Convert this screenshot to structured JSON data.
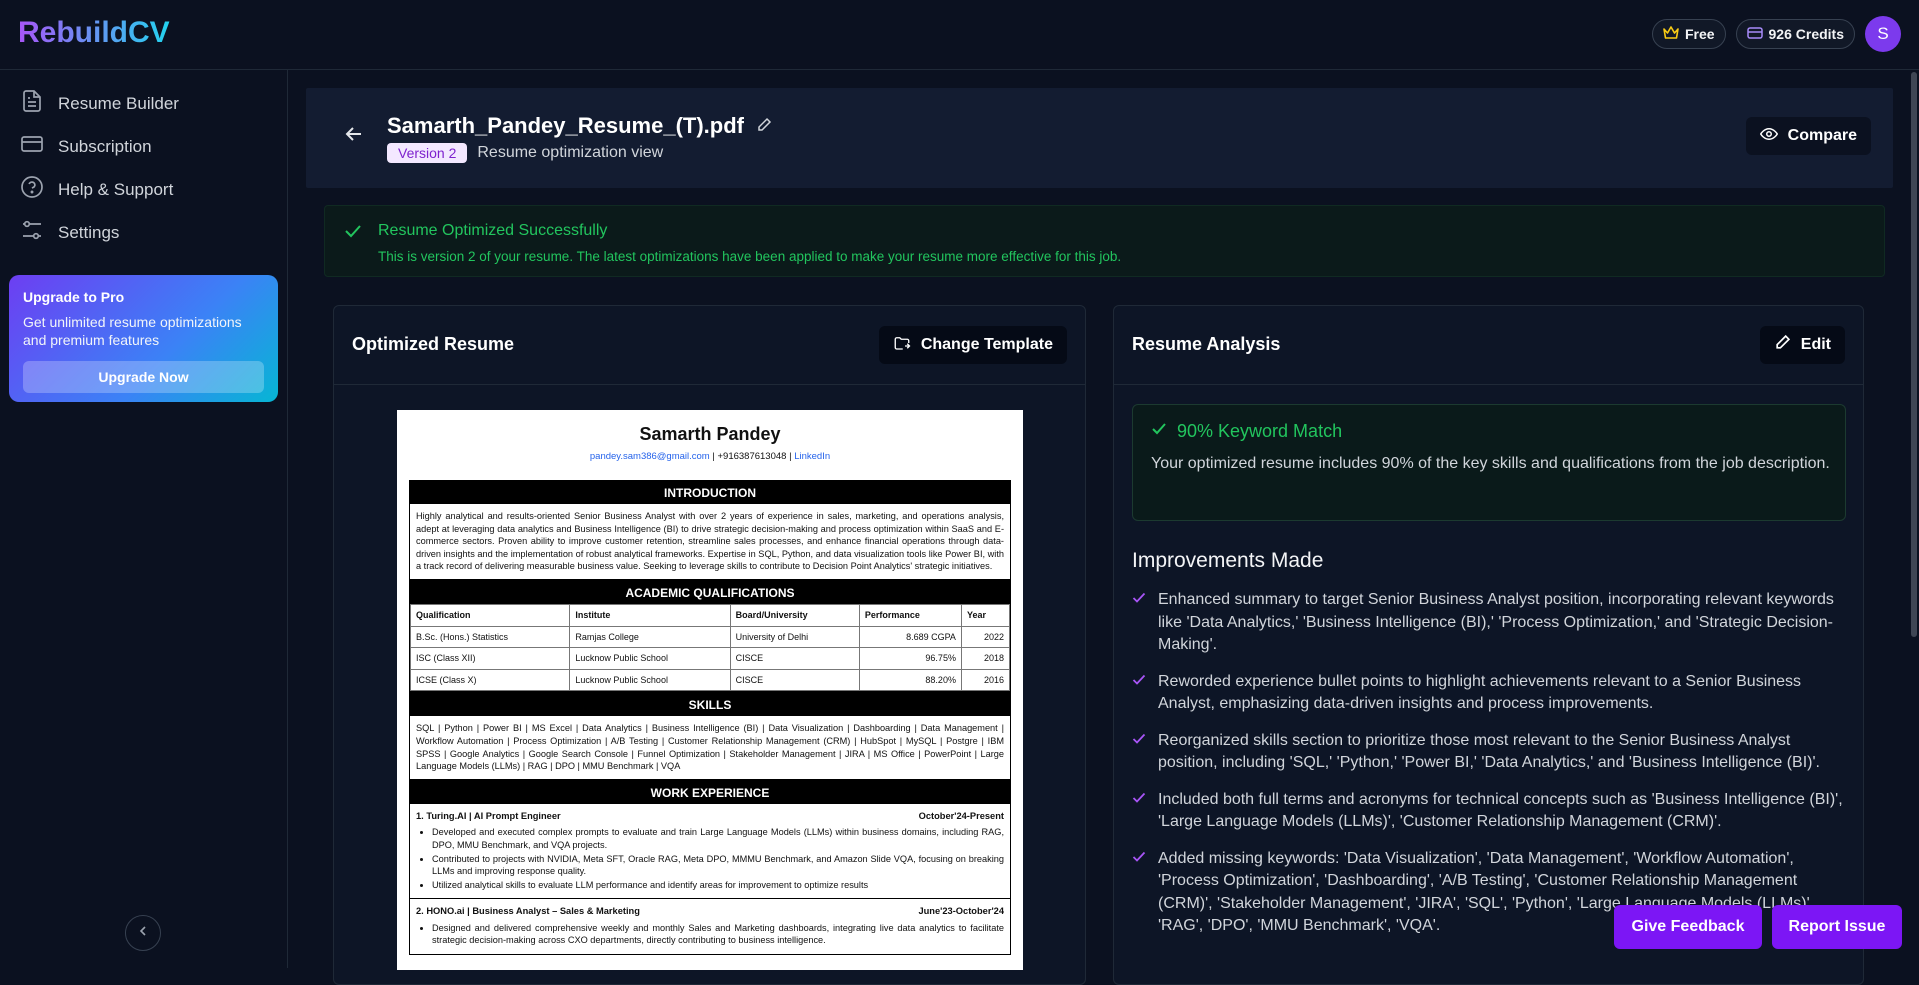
{
  "app": {
    "logo": "RebuildCV",
    "plan": "Free",
    "credits": "926 Credits",
    "avatar_initial": "S"
  },
  "sidebar": {
    "items": [
      {
        "label": "Resume Builder",
        "icon": "document-icon"
      },
      {
        "label": "Subscription",
        "icon": "credit-card-icon"
      },
      {
        "label": "Help & Support",
        "icon": "help-circle-icon"
      },
      {
        "label": "Settings",
        "icon": "sliders-icon"
      }
    ],
    "upgrade": {
      "title": "Upgrade to Pro",
      "text": "Get unlimited resume optimizations and premium features",
      "button": "Upgrade Now"
    }
  },
  "header": {
    "filename": "Samarth_Pandey_Resume_(T).pdf",
    "version": "Version 2",
    "subtitle": "Resume optimization view",
    "compare": "Compare"
  },
  "banner": {
    "title": "Resume Optimized Successfully",
    "text": "This is version 2 of your resume. The latest optimizations have been applied to make your resume more effective for this job."
  },
  "resume_card": {
    "title": "Optimized Resume",
    "change_template": "Change Template"
  },
  "resume": {
    "name": "Samarth Pandey",
    "email": "pandey.sam386@gmail.com",
    "phone": "| +916387613048 |",
    "linkedin": "LinkedIn",
    "sections": {
      "intro": "INTRODUCTION",
      "academic": "ACADEMIC QUALIFICATIONS",
      "skills": "SKILLS",
      "work": "WORK EXPERIENCE"
    },
    "intro_text": "Highly analytical and results-oriented Senior Business Analyst with over 2 years of experience in sales, marketing, and operations analysis, adept at leveraging data analytics and Business Intelligence (BI) to drive strategic decision-making and process optimization within SaaS and E-commerce sectors. Proven ability to improve customer retention, streamline sales processes, and enhance financial operations through data-driven insights and the implementation of robust analytical frameworks. Expertise in SQL, Python, and data visualization tools like Power BI, with a track record of delivering measurable business value. Seeking to leverage skills to contribute to Decision Point Analytics' strategic initiatives.",
    "qual_headers": [
      "Qualification",
      "Institute",
      "Board/University",
      "Performance",
      "Year"
    ],
    "qual_rows": [
      [
        "B.Sc. (Hons.) Statistics",
        "Ramjas College",
        "University of Delhi",
        "8.689 CGPA",
        "2022"
      ],
      [
        "ISC (Class XII)",
        "Lucknow Public School",
        "CISCE",
        "96.75%",
        "2018"
      ],
      [
        "ICSE (Class X)",
        "Lucknow Public School",
        "CISCE",
        "88.20%",
        "2016"
      ]
    ],
    "skills_text": "SQL | Python | Power BI | MS Excel | Data Analytics | Business Intelligence (BI) | Data Visualization | Dashboarding | Data Management | Workflow Automation | Process Optimization | A/B Testing | Customer Relationship Management (CRM) | HubSpot | MySQL | Postgre | IBM SPSS | Google Analytics | Google Search Console | Funnel Optimization | Stakeholder Management | JIRA | MS Office | PowerPoint | Large Language Models (LLMs) | RAG | DPO | MMU Benchmark | VQA",
    "jobs": [
      {
        "title": "1. Turing.AI | AI Prompt Engineer",
        "date": "October'24-Present",
        "bullets": [
          "Developed and executed complex prompts to evaluate and train Large Language Models (LLMs) within business domains, including RAG, DPO, MMU Benchmark, and VQA projects.",
          "Contributed to projects with NVIDIA, Meta SFT, Oracle RAG, Meta DPO, MMMU Benchmark, and Amazon Slide VQA, focusing on breaking LLMs and improving response quality.",
          "Utilized analytical skills to evaluate LLM performance and identify areas for improvement to optimize results"
        ]
      },
      {
        "title": "2. HONO.ai | Business Analyst – Sales & Marketing",
        "date": "June'23-October'24",
        "bullets": [
          "Designed and delivered comprehensive weekly and monthly Sales and Marketing dashboards, integrating live data analytics to facilitate strategic decision-making across CXO departments, directly contributing to business intelligence."
        ]
      }
    ]
  },
  "analysis_card": {
    "title": "Resume Analysis",
    "edit": "Edit",
    "keyword_title": "90% Keyword Match",
    "keyword_text": "Your optimized resume includes 90% of the key skills and qualifications from the job description.",
    "improvements_title": "Improvements Made",
    "improvements": [
      "Enhanced summary to target Senior Business Analyst position, incorporating relevant keywords like 'Data Analytics,' 'Business Intelligence (BI),' 'Process Optimization,' and 'Strategic Decision-Making'.",
      "Reworded experience bullet points to highlight achievements relevant to a Senior Business Analyst, emphasizing data-driven insights and process improvements.",
      "Reorganized skills section to prioritize those most relevant to the Senior Business Analyst position, including 'SQL,' 'Python,' 'Power BI,' 'Data Analytics,' and 'Business Intelligence (BI)'.",
      "Included both full terms and acronyms for technical concepts such as 'Business Intelligence (BI)', 'Large Language Models (LLMs)', 'Customer Relationship Management (CRM)'.",
      "Added missing keywords: 'Data Visualization', 'Data Management', 'Workflow Automation', 'Process Optimization', 'Dashboarding', 'A/B Testing', 'Customer Relationship Management (CRM)', 'Stakeholder Management', 'JIRA', 'SQL', 'Python', 'Large Language Models (LLMs)', 'RAG', 'DPO', 'MMU Benchmark', 'VQA'."
    ]
  },
  "floating": {
    "feedback": "Give Feedback",
    "report": "Report Issue"
  },
  "colors": {
    "accent": "#7c16f5",
    "success": "#22c55e",
    "background": "#0b1120"
  }
}
